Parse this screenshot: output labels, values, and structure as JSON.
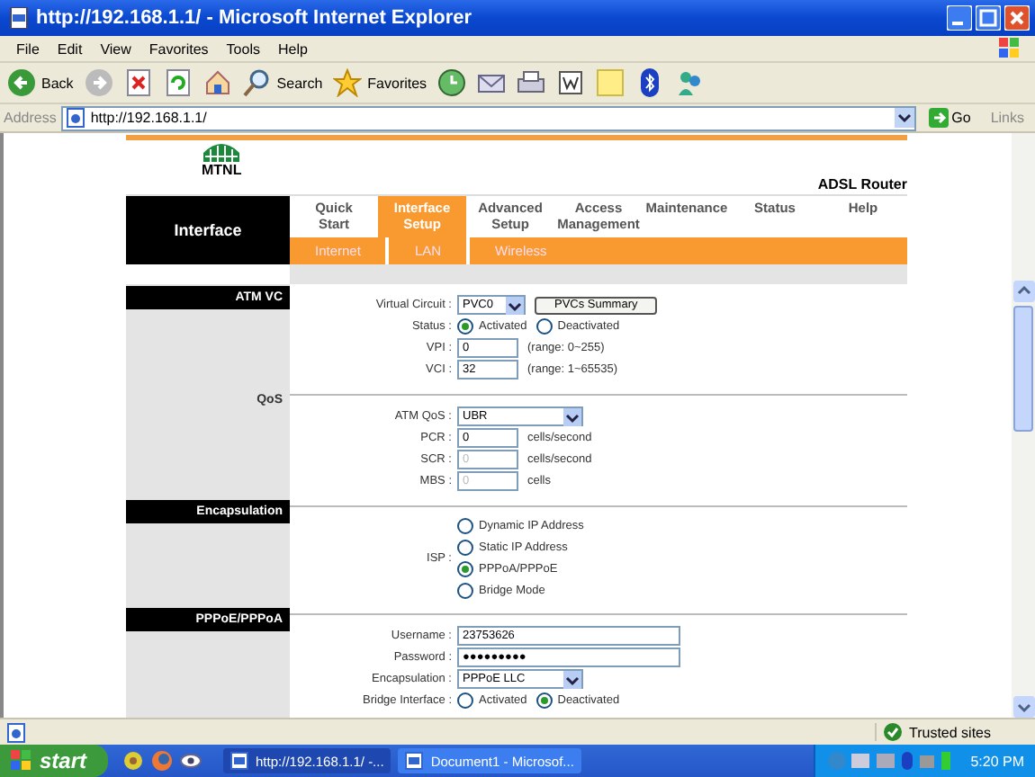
{
  "window": {
    "title": "http://192.168.1.1/ - Microsoft Internet Explorer"
  },
  "menu": [
    "File",
    "Edit",
    "View",
    "Favorites",
    "Tools",
    "Help"
  ],
  "toolbar": [
    {
      "kind": "back",
      "label": "Back"
    },
    {
      "kind": "forward"
    },
    {
      "kind": "stop"
    },
    {
      "kind": "refresh"
    },
    {
      "kind": "home"
    },
    {
      "kind": "search",
      "label": "Search"
    },
    {
      "kind": "favorites",
      "label": "Favorites"
    },
    {
      "kind": "history"
    },
    {
      "kind": "mail"
    },
    {
      "kind": "print"
    },
    {
      "kind": "word"
    },
    {
      "kind": "note"
    },
    {
      "kind": "bluetooth"
    },
    {
      "kind": "messenger"
    }
  ],
  "address_bar": {
    "label": "Address",
    "url": "http://192.168.1.1/",
    "go": "Go",
    "links": "Links"
  },
  "page": {
    "brand": "MTNL",
    "product": "ADSL Router",
    "section_title": "Interface",
    "tabs": [
      {
        "lines": [
          "Quick",
          "Start"
        ],
        "selected": false
      },
      {
        "lines": [
          "Interface",
          "Setup"
        ],
        "selected": true
      },
      {
        "lines": [
          "Advanced",
          "Setup"
        ],
        "selected": false
      },
      {
        "lines": [
          "Access",
          "Management"
        ],
        "selected": false
      },
      {
        "lines": [
          "Maintenance"
        ],
        "selected": false
      },
      {
        "lines": [
          "Status"
        ],
        "selected": false
      },
      {
        "lines": [
          "Help"
        ],
        "selected": false
      }
    ],
    "subtabs": [
      "Internet",
      "LAN",
      "Wireless"
    ],
    "sections": [
      {
        "kind": "header",
        "title": "ATM VC",
        "rows": [
          {
            "kind": "select",
            "label": "Virtual Circuit :",
            "value": "PVC0",
            "button": "PVCs Summary"
          },
          {
            "kind": "radios",
            "label": "Status :",
            "options": [
              {
                "label": "Activated",
                "selected": true
              },
              {
                "label": "Deactivated",
                "selected": false
              }
            ]
          },
          {
            "kind": "input",
            "label": "VPI :",
            "value": "0",
            "hint": "(range: 0~255)",
            "disabled": false
          },
          {
            "kind": "input",
            "label": "VCI :",
            "value": "32",
            "hint": "(range: 1~65535)",
            "disabled": false
          }
        ]
      },
      {
        "kind": "sub",
        "title": "QoS",
        "rows": [
          {
            "kind": "select",
            "label": "ATM QoS :",
            "value": "UBR"
          },
          {
            "kind": "input",
            "label": "PCR :",
            "value": "0",
            "hint": "cells/second",
            "disabled": false
          },
          {
            "kind": "input",
            "label": "SCR :",
            "value": "0",
            "hint": "cells/second",
            "disabled": true
          },
          {
            "kind": "input",
            "label": "MBS :",
            "value": "0",
            "hint": "cells",
            "disabled": true
          }
        ]
      },
      {
        "kind": "header",
        "title": "Encapsulation",
        "rows": [
          {
            "kind": "radio_list",
            "label": "ISP :",
            "options": [
              {
                "label": "Dynamic IP Address",
                "selected": false
              },
              {
                "label": "Static IP Address",
                "selected": false
              },
              {
                "label": "PPPoA/PPPoE",
                "selected": true
              },
              {
                "label": "Bridge Mode",
                "selected": false
              }
            ]
          }
        ]
      },
      {
        "kind": "header",
        "title": "PPPoE/PPPoA",
        "rows": [
          {
            "kind": "wide_input",
            "label": "Username :",
            "value": "23753626"
          },
          {
            "kind": "wide_input",
            "label": "Password :",
            "value": "●●●●●●●●●"
          },
          {
            "kind": "select",
            "label": "Encapsulation :",
            "value": "PPPoE LLC"
          },
          {
            "kind": "radios",
            "label": "Bridge Interface :",
            "options": [
              {
                "label": "Activated",
                "selected": false
              },
              {
                "label": "Deactivated",
                "selected": true
              }
            ]
          }
        ]
      }
    ]
  },
  "status_bar": {
    "zone": "Trusted sites"
  },
  "taskbar": {
    "start": "start",
    "tasks": [
      {
        "label": "http://192.168.1.1/ -...",
        "selected": true
      },
      {
        "label": "Document1 - Microsof...",
        "selected": false
      }
    ],
    "clock": "5:20 PM"
  }
}
